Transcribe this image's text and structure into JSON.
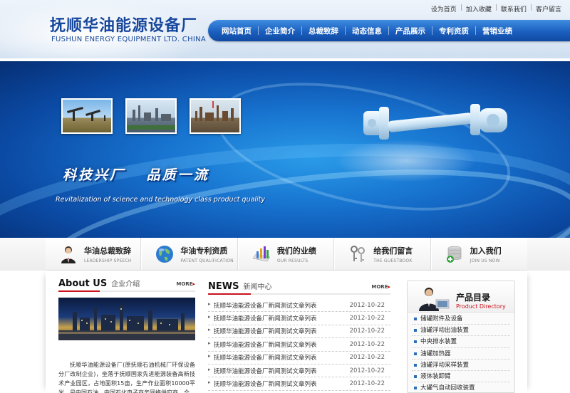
{
  "header": {
    "logo_cn": "抚顺华油能源设备厂",
    "logo_en": "FUSHUN ENERGY EQUIPMENT LTD. CHINA",
    "top_links": [
      "设为首页",
      "加入收藏",
      "联系我们",
      "客户留言"
    ],
    "nav": [
      "网站首页",
      "企业简介",
      "总裁致辞",
      "动态信息",
      "产品展示",
      "专利资质",
      "营销业绩"
    ]
  },
  "banner": {
    "slogan": "科技兴厂 品质一流",
    "slogan_en": "Revitalization of science and technology class product quality"
  },
  "features": [
    {
      "title": "华油总裁致辞",
      "sub": "LEADERSHIP SPEECH",
      "icon": "person-icon"
    },
    {
      "title": "华油专利资质",
      "sub": "PATENT QUALIFICATION",
      "icon": "globe-icon"
    },
    {
      "title": "我们的业绩",
      "sub": "OUR RESULTS",
      "icon": "bar-chart-icon"
    },
    {
      "title": "给我们留言",
      "sub": "THE GUESTBOOK",
      "icon": "keys-icon"
    },
    {
      "title": "加入我们",
      "sub": "JOIN US NOW",
      "icon": "database-add-icon"
    }
  ],
  "about": {
    "title_en": "About US",
    "title_cn": "企业介绍",
    "more": "MORE",
    "text": "抚顺华油能源设备厂(原抚顺石油机械厂环保设备分厂改制企业)，坐落于抚顺国家先进能源装备高新技术产业园区，占地面积15亩，生产作业面积10000平米。是中国石油、中国石化电子商务网络供应商。全"
  },
  "news": {
    "title_en": "NEWS",
    "title_cn": "新闻中心",
    "more": "MORE",
    "items": [
      {
        "title": "抚顺华油能源设备厂新闻测试文章列表",
        "date": "2012-10-22"
      },
      {
        "title": "抚顺华油能源设备厂新闻测试文章列表",
        "date": "2012-10-22"
      },
      {
        "title": "抚顺华油能源设备厂新闻测试文章列表",
        "date": "2012-10-22"
      },
      {
        "title": "抚顺华油能源设备厂新闻测试文章列表",
        "date": "2012-10-22"
      },
      {
        "title": "抚顺华油能源设备厂新闻测试文章列表",
        "date": "2012-10-22"
      },
      {
        "title": "抚顺华油能源设备厂新闻测试文章列表",
        "date": "2012-10-22"
      },
      {
        "title": "抚顺华油能源设备厂新闻测试文章列表",
        "date": "2012-10-22"
      }
    ]
  },
  "catalog": {
    "title": "产品目录",
    "sub": "Product Directory",
    "items": [
      "储罐附件及设备",
      "油罐浮动出油装置",
      "中央排水装置",
      "油罐加热器",
      "油罐浮动采样装置",
      "液体装卸臂",
      "大罐气自动回收装置"
    ]
  }
}
